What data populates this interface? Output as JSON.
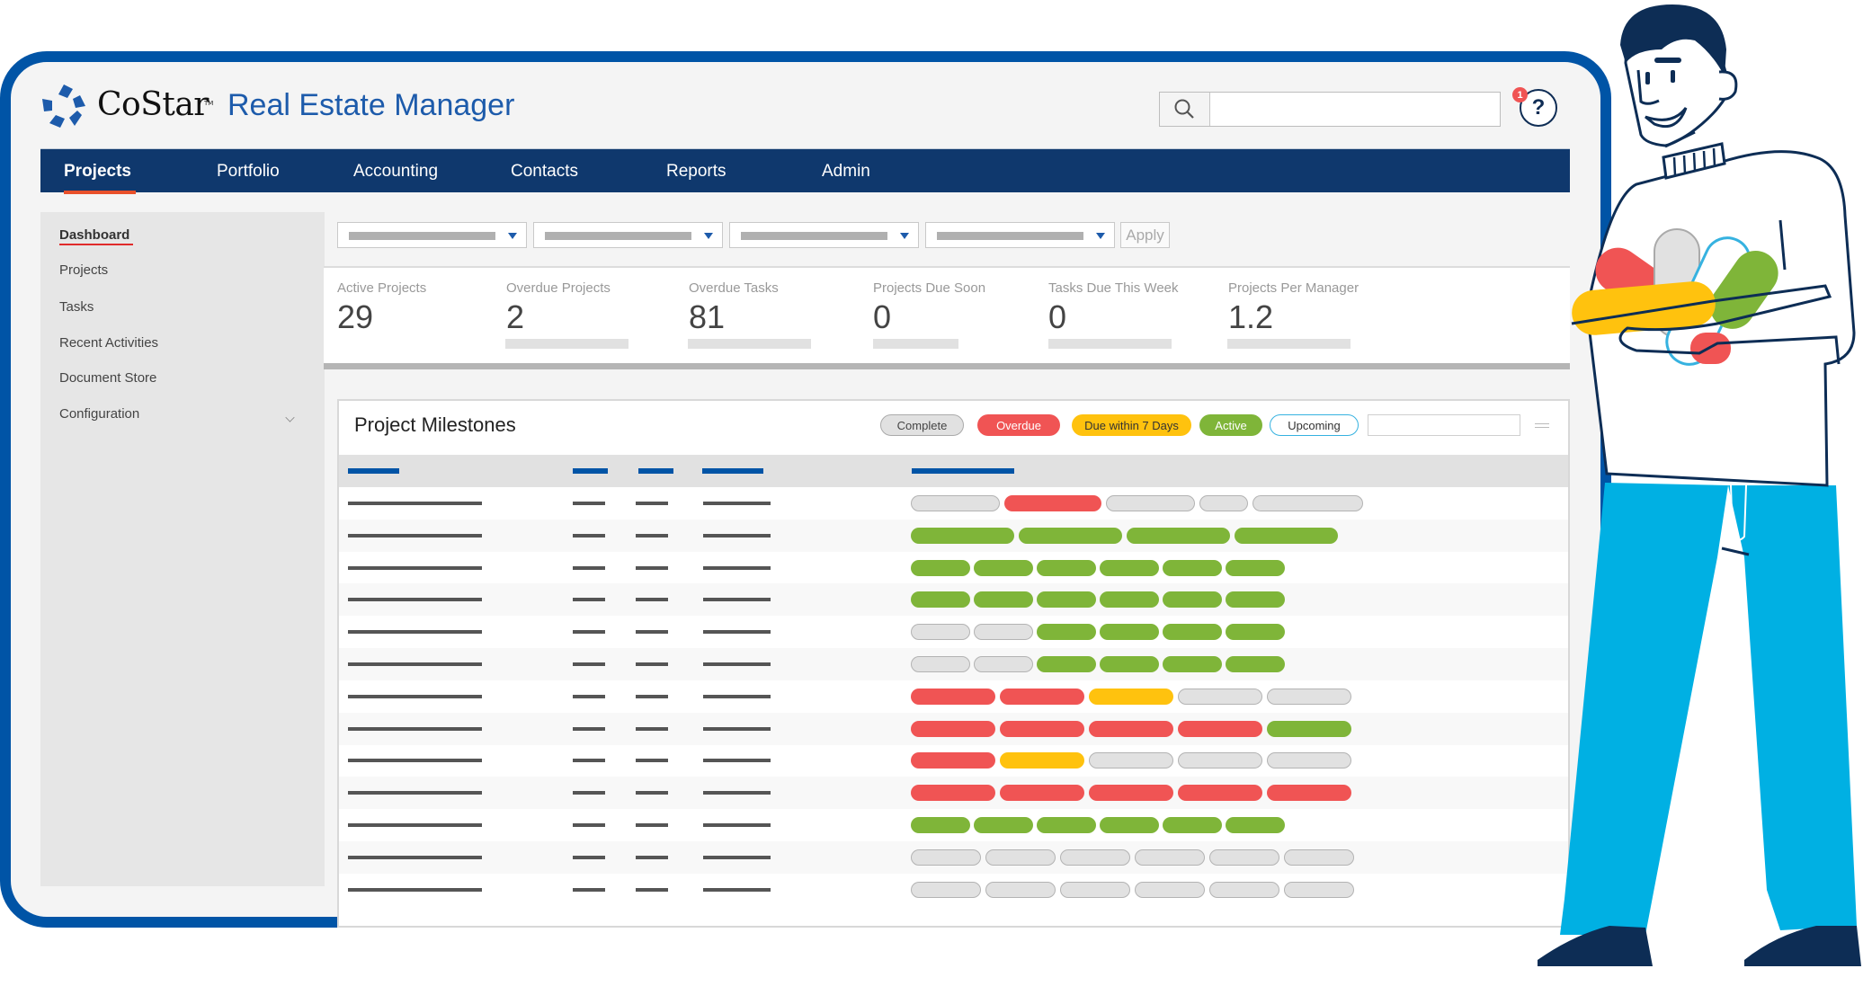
{
  "header": {
    "brand": "CoStar",
    "trademark": "TM",
    "app_title": "Real Estate Manager",
    "search": {
      "placeholder": "",
      "value": "",
      "icon": "search-icon"
    },
    "help": {
      "label": "?",
      "icon": "help-icon",
      "notification_count": "1"
    }
  },
  "nav": {
    "items": [
      {
        "label": "Projects",
        "active": true
      },
      {
        "label": "Portfolio",
        "active": false
      },
      {
        "label": "Accounting",
        "active": false
      },
      {
        "label": "Contacts",
        "active": false
      },
      {
        "label": "Reports",
        "active": false
      },
      {
        "label": "Admin",
        "active": false
      }
    ]
  },
  "sidebar": {
    "items": [
      {
        "label": "Dashboard",
        "active": true
      },
      {
        "label": "Projects",
        "active": false
      },
      {
        "label": "Tasks",
        "active": false
      },
      {
        "label": "Recent Activities",
        "active": false
      },
      {
        "label": "Document Store",
        "active": false
      },
      {
        "label": "Configuration",
        "active": false,
        "expandable": true
      }
    ]
  },
  "filters": {
    "dropdowns": 4,
    "apply_label": "Apply"
  },
  "stats": [
    {
      "label": "Active Projects",
      "value": "29"
    },
    {
      "label": "Overdue Projects",
      "value": "2"
    },
    {
      "label": "Overdue Tasks",
      "value": "81"
    },
    {
      "label": "Projects Due Soon",
      "value": "0"
    },
    {
      "label": "Tasks Due This Week",
      "value": "0"
    },
    {
      "label": "Projects Per Manager",
      "value": "1.2"
    }
  ],
  "milestones": {
    "title": "Project Milestones",
    "legend": [
      {
        "key": "complete",
        "label": "Complete"
      },
      {
        "key": "overdue",
        "label": "Overdue"
      },
      {
        "key": "due7",
        "label": "Due within 7 Days"
      },
      {
        "key": "active",
        "label": "Active"
      },
      {
        "key": "upcoming",
        "label": "Upcoming"
      }
    ],
    "search_placeholder": "",
    "colors": {
      "complete": "#e1e1e1",
      "overdue": "#f05454",
      "due7": "#ffc20e",
      "active": "#7fb539",
      "upcoming": "#36b2e0"
    },
    "rows": [
      [
        "complete",
        "overdue",
        "complete",
        "complete",
        "complete"
      ],
      [
        "active",
        "active",
        "active",
        "active"
      ],
      [
        "active",
        "active",
        "active",
        "active",
        "active",
        "active"
      ],
      [
        "active",
        "active",
        "active",
        "active",
        "active",
        "active"
      ],
      [
        "complete",
        "complete",
        "active",
        "active",
        "active",
        "active"
      ],
      [
        "complete",
        "complete",
        "active",
        "active",
        "active",
        "active"
      ],
      [
        "overdue",
        "overdue",
        "due7",
        "complete",
        "complete"
      ],
      [
        "overdue",
        "overdue",
        "overdue",
        "overdue",
        "active"
      ],
      [
        "overdue",
        "due7",
        "complete",
        "complete",
        "complete"
      ],
      [
        "overdue",
        "overdue",
        "overdue",
        "overdue",
        "overdue"
      ],
      [
        "active",
        "active",
        "active",
        "active",
        "active",
        "active"
      ],
      [
        "complete",
        "complete",
        "complete",
        "complete",
        "complete",
        "complete"
      ],
      [
        "complete",
        "complete",
        "complete",
        "complete",
        "complete",
        "complete"
      ]
    ]
  },
  "brand_colors": {
    "frame": "#0054a6",
    "nav": "#0f386d",
    "accent_title": "#1d5bab",
    "nav_active_underline": "#e8502a"
  }
}
